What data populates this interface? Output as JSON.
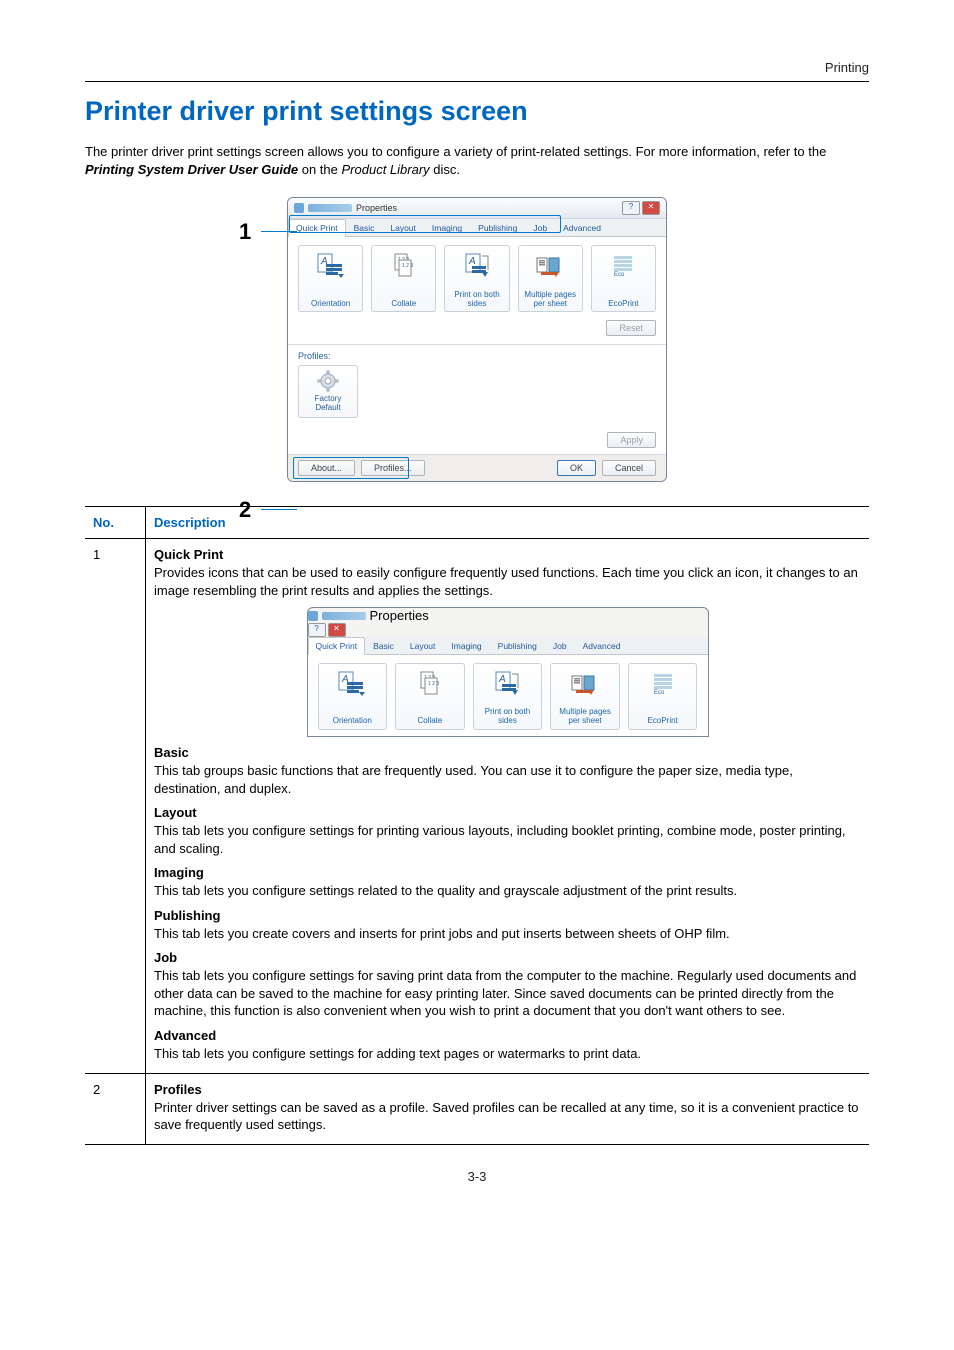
{
  "header": {
    "section": "Printing"
  },
  "title": "Printer driver print settings screen",
  "intro": {
    "part1": "The printer driver print settings screen allows you to configure a variety of print-related settings. For more information, refer to the ",
    "ref1": "Printing System Driver User Guide",
    "part2": " on the ",
    "ref2": "Product Library",
    "part3": " disc."
  },
  "callouts": {
    "one": "1",
    "two": "2"
  },
  "dialog": {
    "title": "Properties",
    "tabs": {
      "quick": "Quick Print",
      "basic": "Basic",
      "layout": "Layout",
      "imaging": "Imaging",
      "publishing": "Publishing",
      "job": "Job",
      "advanced": "Advanced"
    },
    "icons": {
      "orientation": "Orientation",
      "collate": "Collate",
      "duplex": "Print on both sides",
      "multipage": "Multiple pages per sheet",
      "ecoprint": "EcoPrint",
      "eco_tag": "Eco"
    },
    "buttons": {
      "reset": "Reset",
      "apply": "Apply",
      "about": "About...",
      "profiles": "Profiles...",
      "ok": "OK",
      "cancel": "Cancel"
    },
    "profiles_label": "Profiles:",
    "factory_default": "Factory Default"
  },
  "table": {
    "head_no": "No.",
    "head_desc": "Description",
    "rows": {
      "r1": {
        "no": "1",
        "quick_head": "Quick Print",
        "quick_body": "Provides icons that can be used to easily configure frequently used functions. Each time you click an icon, it changes to an image resembling the print results and applies the settings.",
        "basic_head": "Basic",
        "basic_body": "This tab groups basic functions that are frequently used. You can use it to configure the paper size, media type, destination, and duplex.",
        "layout_head": "Layout",
        "layout_body": "This tab lets you configure settings for printing various layouts, including booklet printing, combine mode, poster printing, and scaling.",
        "imaging_head": "Imaging",
        "imaging_body": "This tab lets you configure settings related to the quality and grayscale adjustment of the print results.",
        "publishing_head": "Publishing",
        "publishing_body": "This tab lets you create covers and inserts for print jobs and put inserts between sheets of OHP film.",
        "job_head": "Job",
        "job_body": "This tab lets you configure settings for saving print data from the computer to the machine. Regularly used documents and other data can be saved to the machine for easy printing later. Since saved documents can be printed directly from the machine, this function is also convenient when you wish to print a document that you don't want others to see.",
        "advanced_head": "Advanced",
        "advanced_body": "This tab lets you configure settings for adding text pages or watermarks to print data."
      },
      "r2": {
        "no": "2",
        "profiles_head": "Profiles",
        "profiles_body": "Printer driver settings can be saved as a profile. Saved profiles can be recalled at any time, so it is a convenient practice to save frequently used settings."
      }
    }
  },
  "footer": "3-3"
}
